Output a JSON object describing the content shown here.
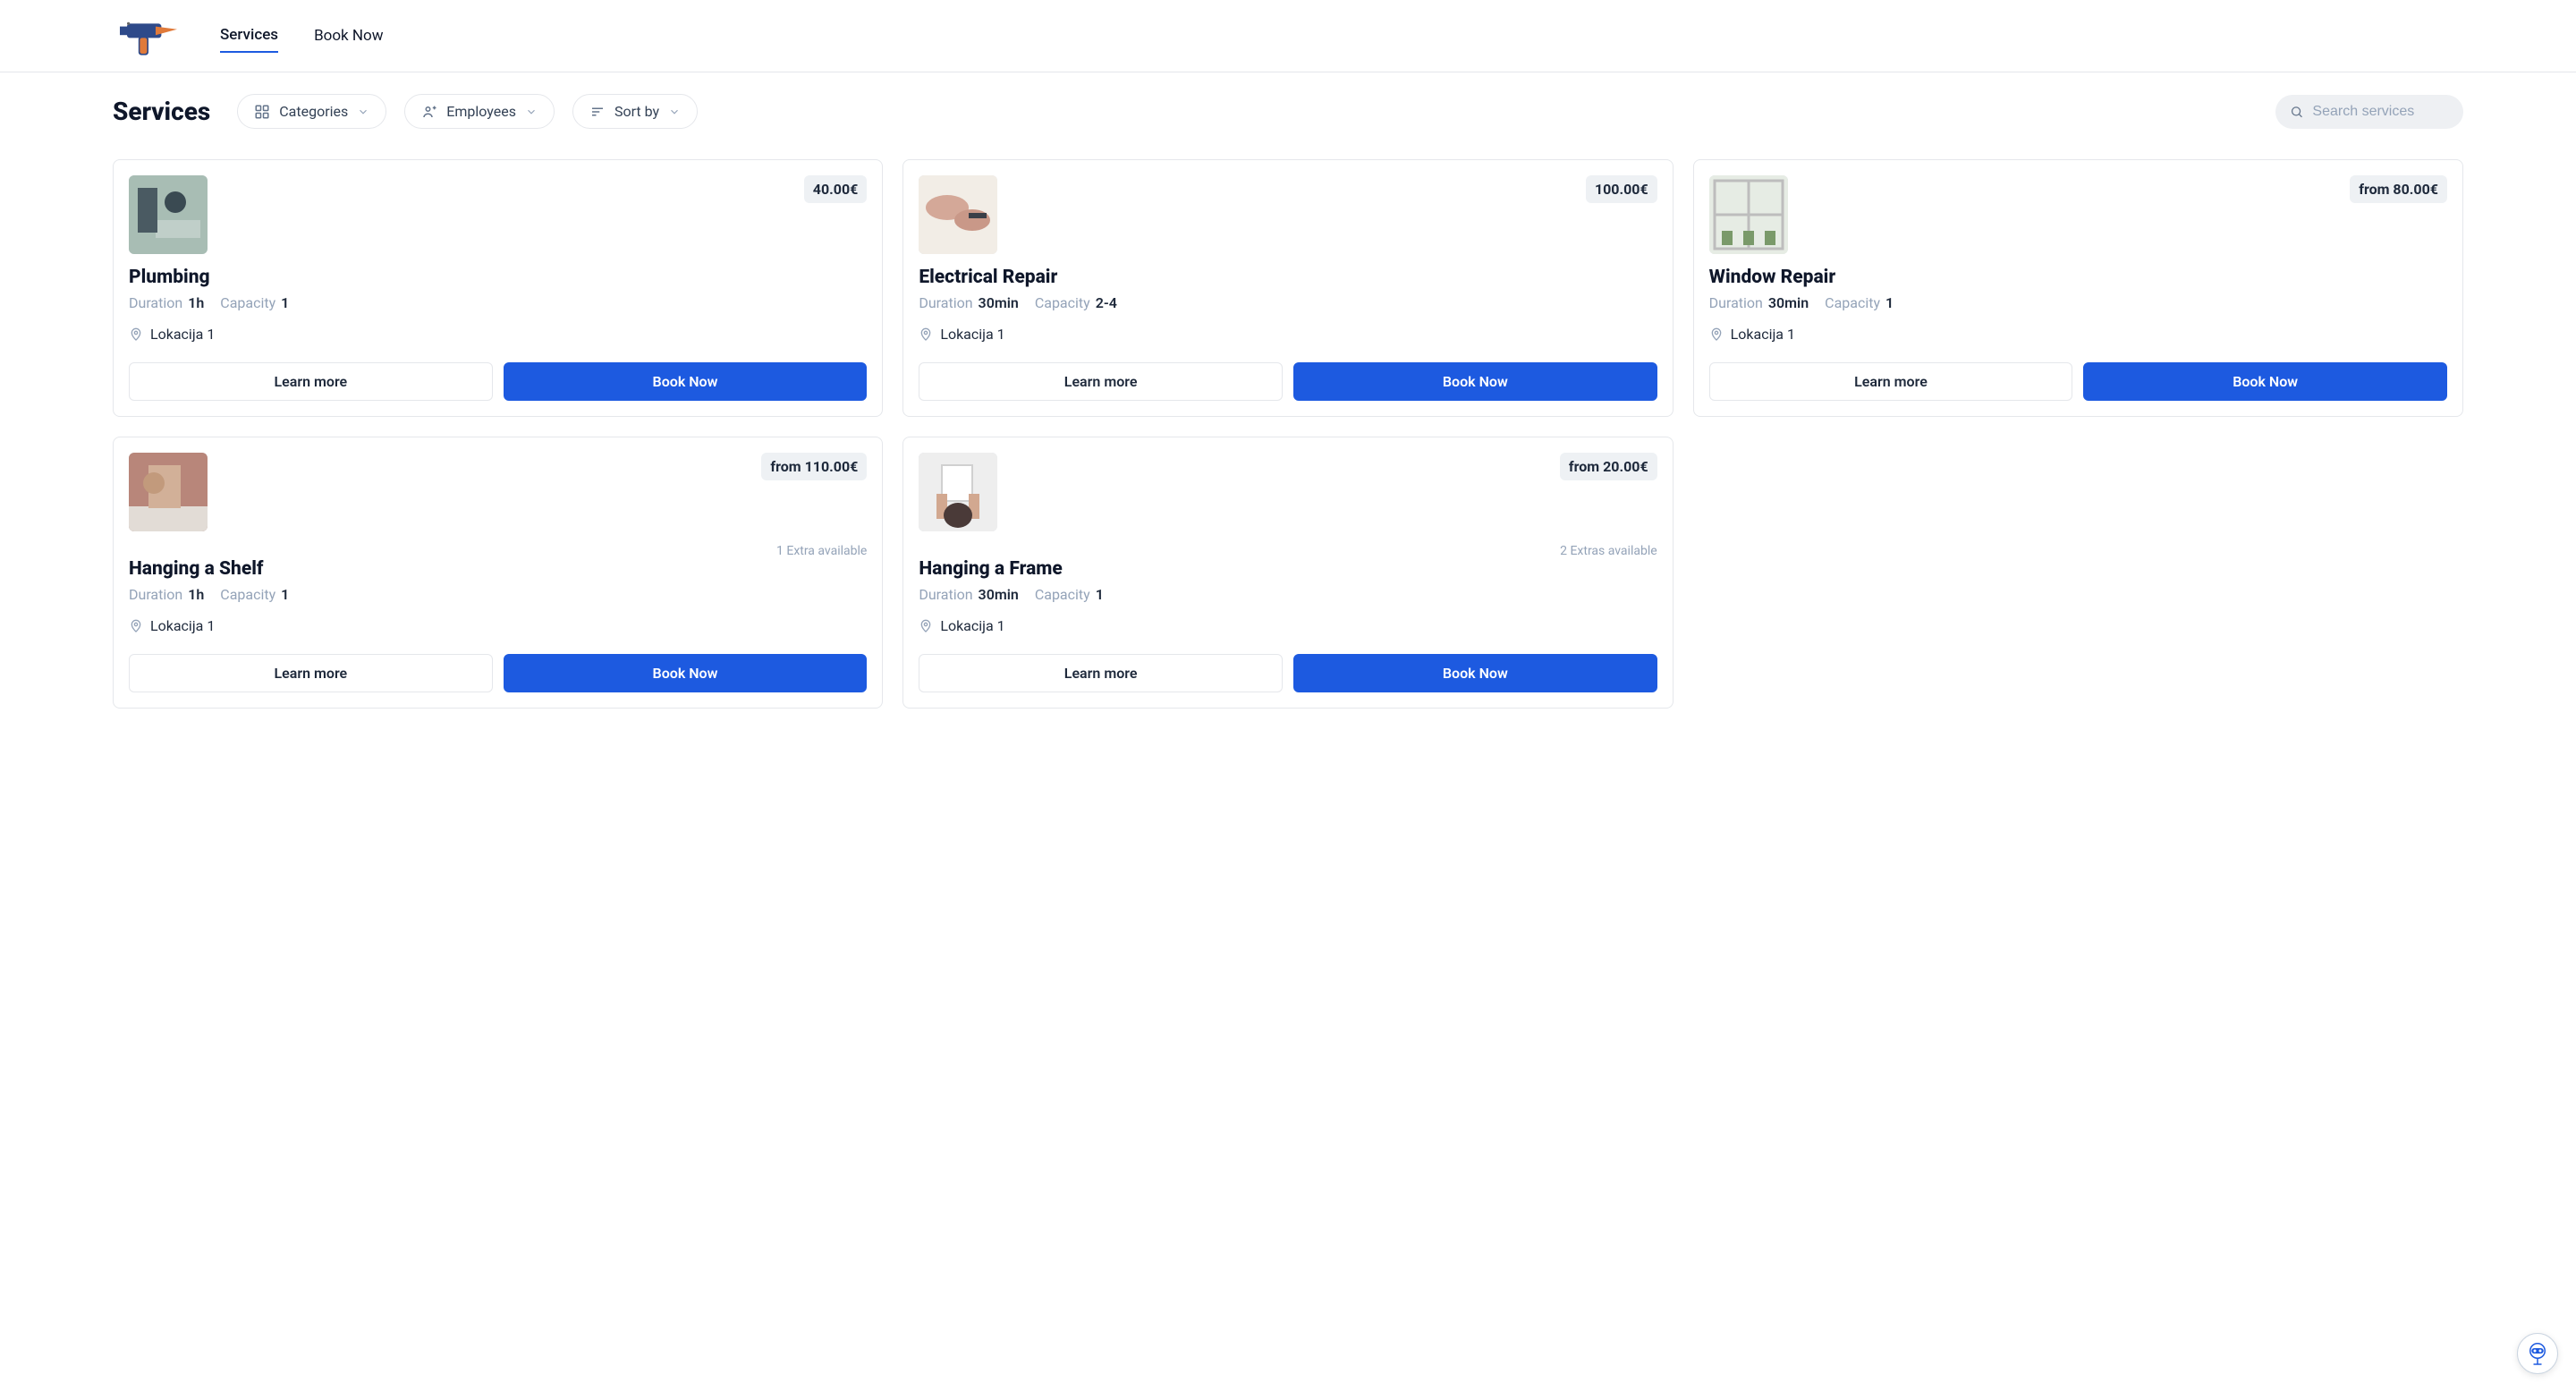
{
  "nav": {
    "services": "Services",
    "book_now": "Book Now"
  },
  "page": {
    "title": "Services"
  },
  "filters": {
    "categories": "Categories",
    "employees": "Employees",
    "sort_by": "Sort by"
  },
  "search": {
    "placeholder": "Search services"
  },
  "labels": {
    "duration": "Duration",
    "capacity": "Capacity",
    "learn_more": "Learn more",
    "book_now": "Book Now"
  },
  "services": [
    {
      "title": "Plumbing",
      "price": "40.00€",
      "from": false,
      "duration": "1h",
      "capacity": "1",
      "location": "Lokacija 1",
      "extras": null
    },
    {
      "title": "Electrical Repair",
      "price": "100.00€",
      "from": false,
      "duration": "30min",
      "capacity": "2-4",
      "location": "Lokacija 1",
      "extras": null
    },
    {
      "title": "Window Repair",
      "price": "from 80.00€",
      "from": true,
      "duration": "30min",
      "capacity": "1",
      "location": "Lokacija 1",
      "extras": null
    },
    {
      "title": "Hanging a Shelf",
      "price": "from 110.00€",
      "from": true,
      "duration": "1h",
      "capacity": "1",
      "location": "Lokacija 1",
      "extras": "1 Extra available"
    },
    {
      "title": "Hanging a Frame",
      "price": "from 20.00€",
      "from": true,
      "duration": "30min",
      "capacity": "1",
      "location": "Lokacija 1",
      "extras": "2 Extras available"
    }
  ]
}
